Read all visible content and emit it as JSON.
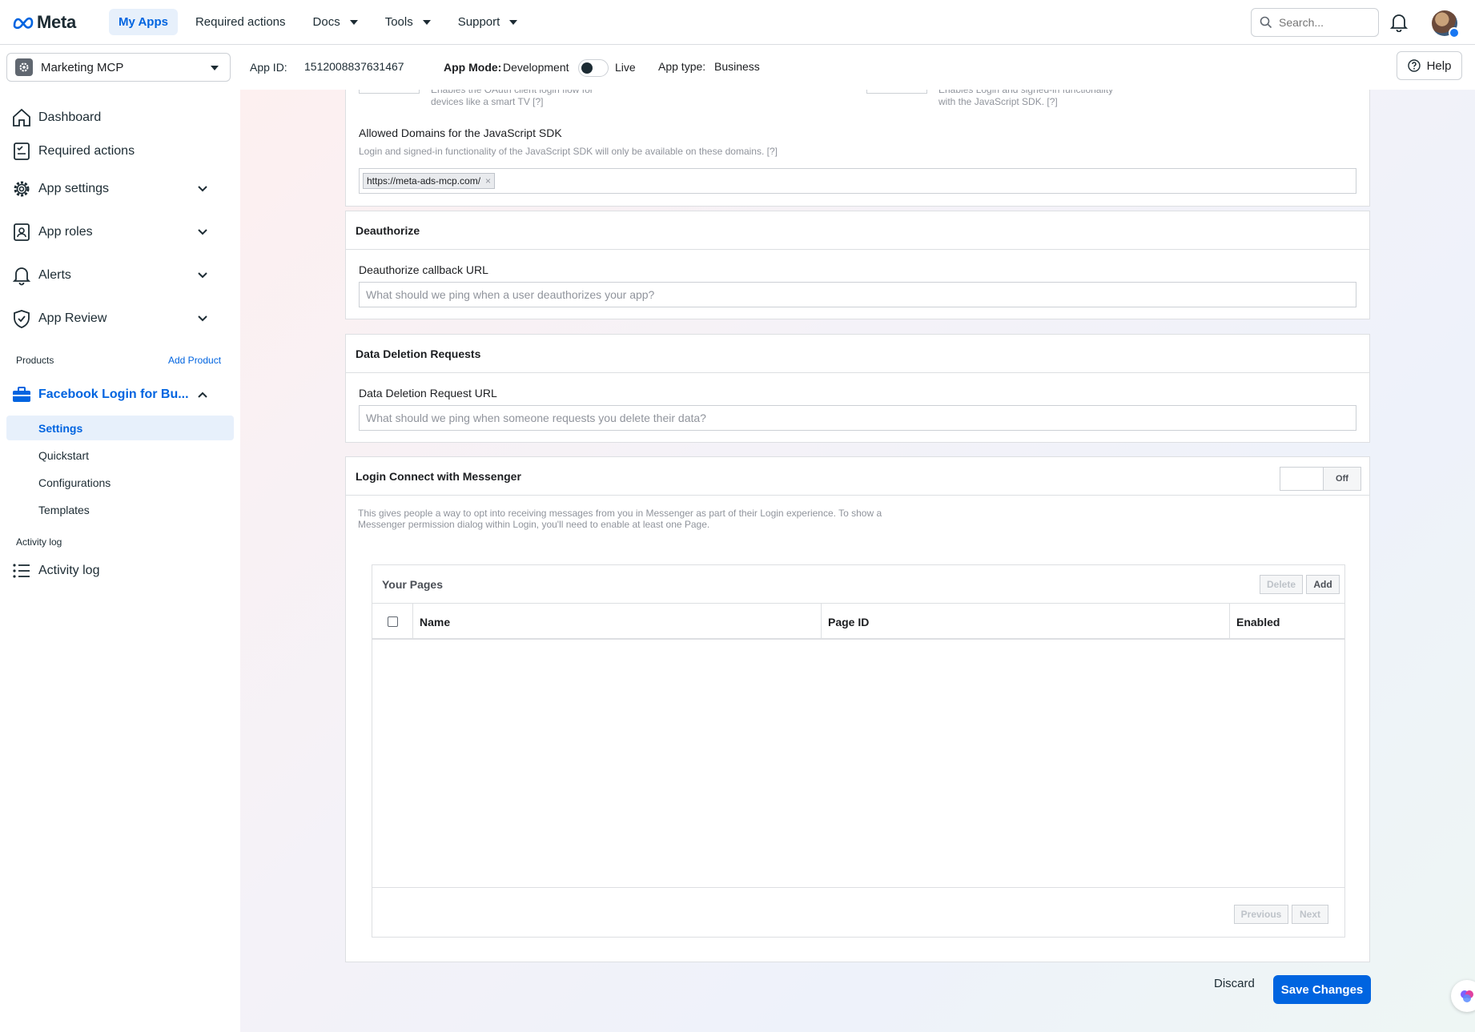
{
  "topnav": {
    "brand": "Meta",
    "items": [
      {
        "label": "My Apps",
        "active": true
      },
      {
        "label": "Required actions",
        "active": false
      },
      {
        "label": "Docs",
        "dropdown": true
      },
      {
        "label": "Tools",
        "dropdown": true
      },
      {
        "label": "Support",
        "dropdown": true
      }
    ],
    "search_placeholder": "Search..."
  },
  "subheader": {
    "app_name": "Marketing MCP",
    "app_id_label": "App ID:",
    "app_id": "1512008837631467",
    "app_mode_label": "App Mode:",
    "app_mode_value": "Development",
    "app_mode_live": "Live",
    "app_type_label": "App type:",
    "app_type_value": "Business",
    "help_label": "Help"
  },
  "sidebar": {
    "items": [
      {
        "label": "Dashboard",
        "icon": "home-icon"
      },
      {
        "label": "Required actions",
        "icon": "checklist-icon"
      },
      {
        "label": "App settings",
        "icon": "gear-icon"
      },
      {
        "label": "App roles",
        "icon": "id-badge-icon"
      },
      {
        "label": "Alerts",
        "icon": "bell-icon"
      },
      {
        "label": "App Review",
        "icon": "shield-check-icon"
      }
    ],
    "products_label": "Products",
    "add_product_label": "Add Product",
    "product_name": "Facebook Login for Bu...",
    "product_sub_items": [
      "Settings",
      "Quickstart",
      "Configurations",
      "Templates"
    ],
    "activity_section_label": "Activity log",
    "activity_item_label": "Activity log"
  },
  "top_fragment": {
    "left_hint_line1": "Enables the OAuth client login flow for",
    "left_hint_line2": "devices like a smart TV",
    "right_hint_line1": "Enables Login and signed-in functionality",
    "right_hint_line2": "with the JavaScript SDK.",
    "help_mark": "[?]",
    "allowed_domains_label": "Allowed Domains for the JavaScript SDK",
    "allowed_domains_hint": "Login and signed-in functionality of the JavaScript SDK will only be available on these domains.",
    "allowed_domains_hint_mark": "[?]",
    "domain_chip": "https://meta-ads-mcp.com/",
    "chip_remove": "×"
  },
  "deauthorize": {
    "title": "Deauthorize",
    "field_label": "Deauthorize callback URL",
    "placeholder": "What should we ping when a user deauthorizes your app?"
  },
  "data_deletion": {
    "title": "Data Deletion Requests",
    "field_label": "Data Deletion Request URL",
    "placeholder": "What should we ping when someone requests you delete their data?"
  },
  "messenger": {
    "title": "Login Connect with Messenger",
    "toggle_label": "Off",
    "description_line1": "This gives people a way to opt into receiving messages from you in Messenger as part of their Login experience. To show a",
    "description_line2": "Messenger permission dialog within Login, you'll need to enable at least one Page.",
    "pages": {
      "title": "Your Pages",
      "delete_label": "Delete",
      "add_label": "Add",
      "columns": [
        "Name",
        "Page ID",
        "Enabled"
      ],
      "previous_label": "Previous",
      "next_label": "Next"
    }
  },
  "footer": {
    "discard_label": "Discard",
    "save_label": "Save Changes"
  },
  "colors": {
    "accent": "#0064e0",
    "border": "#dddfe2",
    "muted_text": "#90949c"
  }
}
